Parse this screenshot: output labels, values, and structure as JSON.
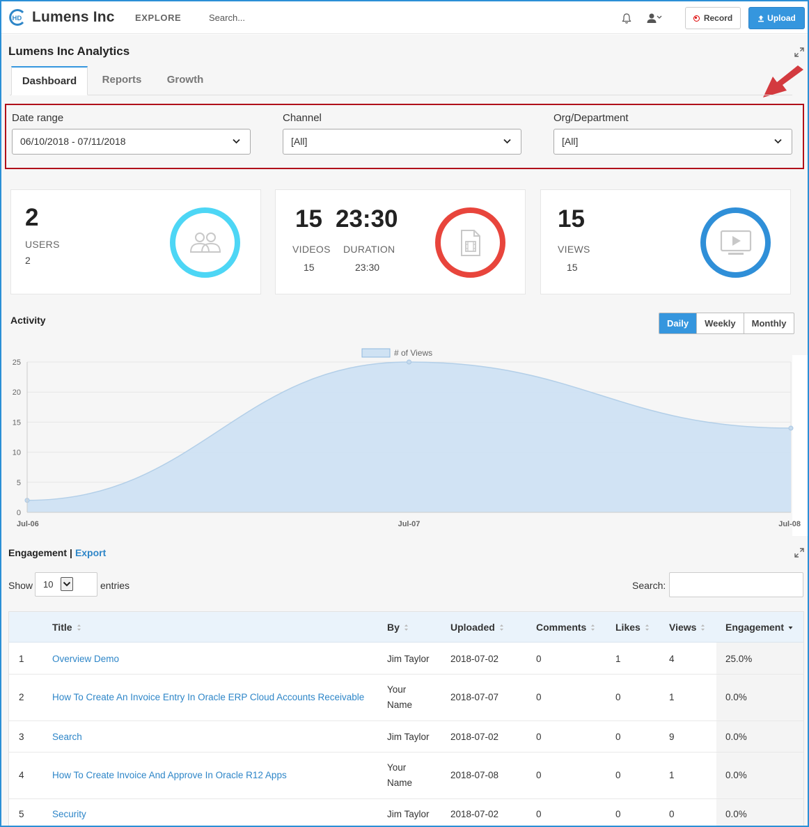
{
  "topbar": {
    "logo_text": "HD",
    "brand": "Lumens Inc",
    "explore": "EXPLORE",
    "search_placeholder": "Search...",
    "record_label": "Record",
    "upload_label": "Upload",
    "icons": [
      "bell-icon",
      "user-icon",
      "record-dot-icon",
      "upload-icon"
    ]
  },
  "page": {
    "title": "Lumens Inc Analytics",
    "tabs": [
      {
        "label": "Dashboard",
        "active": true
      },
      {
        "label": "Reports",
        "active": false
      },
      {
        "label": "Growth",
        "active": false
      }
    ]
  },
  "filters": {
    "date_range": {
      "label": "Date range",
      "value": "06/10/2018 - 07/11/2018"
    },
    "channel": {
      "label": "Channel",
      "value": "[All]"
    },
    "org": {
      "label": "Org/Department",
      "value": "[All]"
    }
  },
  "stats": {
    "users": {
      "big": "2",
      "label": "USERS",
      "value": "2",
      "ring_color": "#4dd6f5"
    },
    "videos": {
      "big": "15",
      "label": "VIDEOS",
      "value": "15"
    },
    "duration": {
      "big": "23:30",
      "label": "DURATION",
      "value": "23:30",
      "ring_color": "#e8453c"
    },
    "views": {
      "big": "15",
      "label": "VIEWS",
      "value": "15",
      "ring_color": "#2f8fd8"
    }
  },
  "activity": {
    "title": "Activity",
    "periods": [
      {
        "label": "Daily",
        "active": true
      },
      {
        "label": "Weekly",
        "active": false
      },
      {
        "label": "Monthly",
        "active": false
      }
    ]
  },
  "chart_data": {
    "type": "area",
    "x": [
      "Jul-06",
      "Jul-07",
      "Jul-08"
    ],
    "series": [
      {
        "name": "# of Views",
        "values": [
          2,
          25,
          14
        ]
      }
    ],
    "ylim": [
      0,
      25
    ],
    "yticks": [
      0,
      5,
      10,
      15,
      20,
      25
    ],
    "legend": "top-center",
    "grid": true,
    "fill_color": "#cfe2f3",
    "line_color": "#b3cfe8"
  },
  "engagement": {
    "title": "Engagement",
    "separator": "|",
    "export": "Export",
    "show_label": "Show",
    "page_length": "10",
    "entries_label": "entries",
    "search_label": "Search:",
    "columns": [
      "Title",
      "By",
      "Uploaded",
      "Comments",
      "Likes",
      "Views",
      "Engagement"
    ],
    "rows": [
      {
        "n": "1",
        "title": "Overview Demo",
        "by": "Jim Taylor",
        "uploaded": "2018-07-02",
        "comments": "0",
        "likes": "1",
        "views": "4",
        "engagement": "25.0%"
      },
      {
        "n": "2",
        "title": "How To Create An Invoice Entry In Oracle ERP Cloud Accounts Receivable",
        "by": "Your Name",
        "uploaded": "2018-07-07",
        "comments": "0",
        "likes": "0",
        "views": "1",
        "engagement": "0.0%"
      },
      {
        "n": "3",
        "title": "Search",
        "by": "Jim Taylor",
        "uploaded": "2018-07-02",
        "comments": "0",
        "likes": "0",
        "views": "9",
        "engagement": "0.0%"
      },
      {
        "n": "4",
        "title": "How To Create Invoice And Approve In Oracle R12 Apps",
        "by": "Your Name",
        "uploaded": "2018-07-08",
        "comments": "0",
        "likes": "0",
        "views": "1",
        "engagement": "0.0%"
      },
      {
        "n": "5",
        "title": "Security",
        "by": "Jim Taylor",
        "uploaded": "2018-07-02",
        "comments": "0",
        "likes": "0",
        "views": "0",
        "engagement": "0.0%"
      }
    ]
  }
}
